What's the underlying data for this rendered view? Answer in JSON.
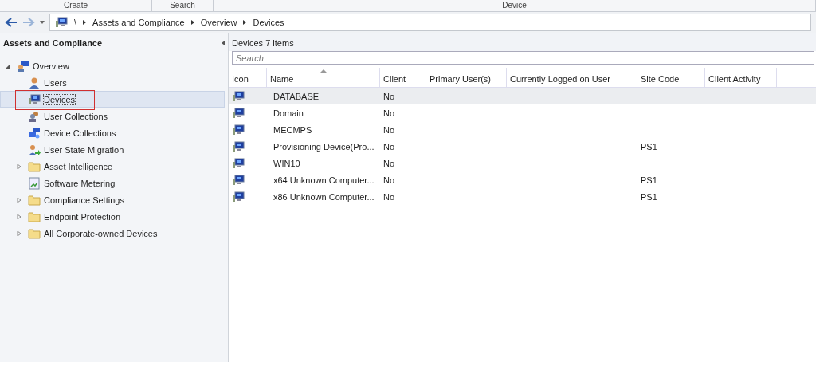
{
  "ribbon_groups": [
    "Create",
    "Search",
    "Device"
  ],
  "address_bar": {
    "path": [
      "\\",
      "Assets and Compliance",
      "Overview",
      "Devices"
    ]
  },
  "navigation_pane": {
    "title": "Assets and Compliance",
    "tree": [
      {
        "label": "Overview",
        "kind": "overview",
        "expanded": true,
        "selected": false,
        "children": [
          {
            "label": "Users",
            "kind": "user",
            "selected": false
          },
          {
            "label": "Devices",
            "kind": "device",
            "selected": true
          },
          {
            "label": "User Collections",
            "kind": "user-collection",
            "selected": false
          },
          {
            "label": "Device Collections",
            "kind": "device-collection",
            "selected": false
          },
          {
            "label": "User State Migration",
            "kind": "migration",
            "selected": false
          },
          {
            "label": "Asset Intelligence",
            "kind": "folder",
            "expanded": false,
            "selected": false
          },
          {
            "label": "Software Metering",
            "kind": "metering",
            "selected": false
          },
          {
            "label": "Compliance Settings",
            "kind": "folder",
            "expanded": false,
            "selected": false
          },
          {
            "label": "Endpoint Protection",
            "kind": "folder",
            "expanded": false,
            "selected": false
          },
          {
            "label": "All Corporate-owned Devices",
            "kind": "folder",
            "expanded": false,
            "selected": false
          }
        ]
      }
    ]
  },
  "list_pane": {
    "title": "Devices 7 items",
    "search": {
      "placeholder": "Search"
    },
    "columns": [
      {
        "label": "Icon",
        "sorted": false
      },
      {
        "label": "Name",
        "sorted": true
      },
      {
        "label": "Client",
        "sorted": false
      },
      {
        "label": "Primary User(s)",
        "sorted": false
      },
      {
        "label": "Currently Logged on User",
        "sorted": false
      },
      {
        "label": "Site Code",
        "sorted": false
      },
      {
        "label": "Client Activity",
        "sorted": false
      }
    ],
    "rows": [
      {
        "name": "DATABASE",
        "client": "No",
        "site_code": "",
        "selected": true
      },
      {
        "name": "Domain",
        "client": "No",
        "site_code": "",
        "selected": false
      },
      {
        "name": "MECMPS",
        "client": "No",
        "site_code": "",
        "selected": false
      },
      {
        "name": "Provisioning Device(Pro...",
        "client": "No",
        "site_code": "PS1",
        "selected": false
      },
      {
        "name": "WIN10",
        "client": "No",
        "site_code": "",
        "selected": false
      },
      {
        "name": "x64 Unknown Computer...",
        "client": "No",
        "site_code": "PS1",
        "selected": false
      },
      {
        "name": "x86 Unknown Computer...",
        "client": "No",
        "site_code": "PS1",
        "selected": false
      }
    ]
  }
}
